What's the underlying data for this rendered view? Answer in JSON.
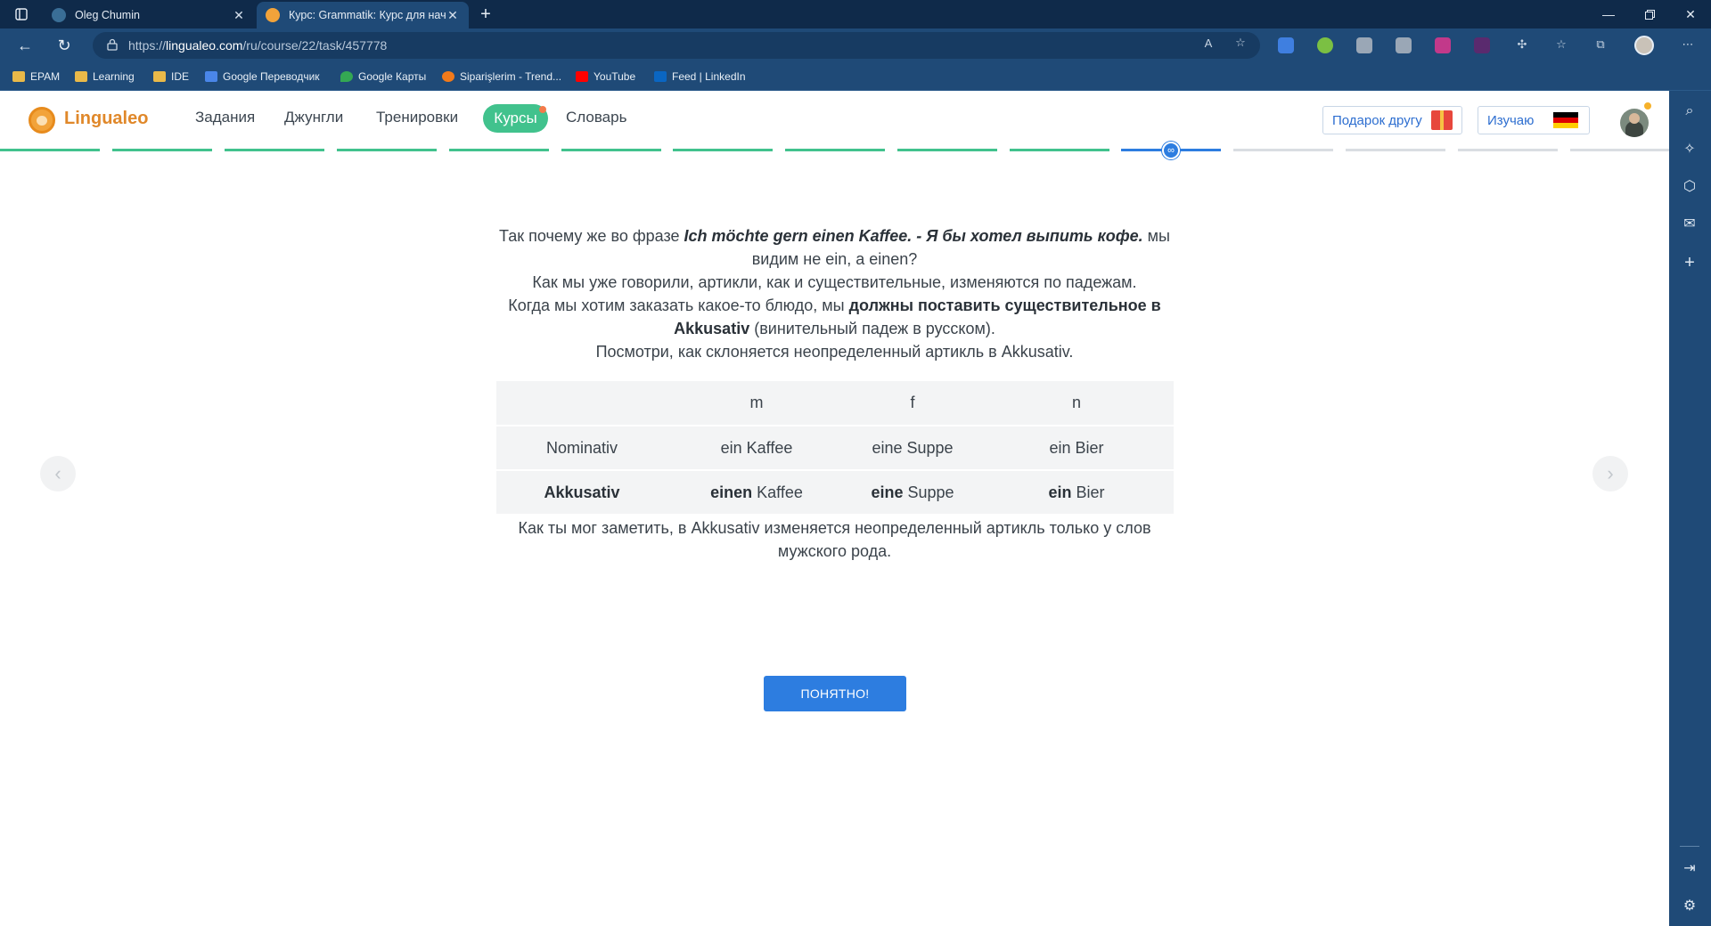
{
  "browser": {
    "tabs": [
      {
        "title": "Oleg Chumin",
        "active": false
      },
      {
        "title": "Курс: Grammatik: Курс для начи",
        "active": true
      }
    ],
    "new_tab": "+",
    "url_prefix": "https://",
    "url_host": "lingualeo.com",
    "url_path": "/ru/course/22/task/457778",
    "bookmarks": [
      {
        "label": "EPAM",
        "icon": "folder-icon"
      },
      {
        "label": "Learning",
        "icon": "folder-icon"
      },
      {
        "label": "IDE",
        "icon": "folder-icon"
      },
      {
        "label": "Google Переводчик",
        "icon": "google-translate-icon"
      },
      {
        "label": "Google Карты",
        "icon": "google-maps-icon"
      },
      {
        "label": "Siparişlerim - Trend...",
        "icon": "trendyol-icon"
      },
      {
        "label": "YouTube",
        "icon": "youtube-icon"
      },
      {
        "label": "Feed | LinkedIn",
        "icon": "linkedin-icon"
      }
    ]
  },
  "site": {
    "logo": "Lingualeo",
    "nav": [
      {
        "label": "Задания"
      },
      {
        "label": "Джунгли"
      },
      {
        "label": "Тренировки"
      },
      {
        "label": "Курсы",
        "active": true
      },
      {
        "label": "Словарь"
      }
    ],
    "gift_button": "Подарок другу",
    "learning_button": "Изучаю",
    "progress": {
      "segments_total": 15,
      "completed": 10,
      "current_index": 10
    }
  },
  "lesson": {
    "line1_a": "Так почему же во фразе ",
    "line1_em": "Ich möchte gern einen Kaffee. - Я бы хотел выпить кофе.",
    "line1_b": " мы",
    "line2": "видим не ein, а einen?",
    "line3": "Как мы уже говорили, артикли, как и существительные, изменяются по падежам.",
    "line4_a": "Когда мы хотим заказать какое-то блюдо, мы ",
    "line4_b": "должны поставить существительное в",
    "line5_b": "Akkusativ",
    "line5_a": " (винительный падеж в русском).",
    "line6": "Посмотри, как склоняется неопределенный артикль в Akkusativ.",
    "table": {
      "headers": [
        "",
        "m",
        "f",
        "n"
      ],
      "rows": [
        {
          "case": "Nominativ",
          "m_art": "ein",
          "m_noun": "Kaffee",
          "f_art": "eine",
          "f_noun": "Suppe",
          "n_art": "ein",
          "n_noun": "Bier",
          "bold": false
        },
        {
          "case": "Akkusativ",
          "m_art": "einen",
          "m_noun": "Kaffee",
          "f_art": "eine",
          "f_noun": "Suppe",
          "n_art": "ein",
          "n_noun": "Bier",
          "bold": true
        }
      ]
    },
    "after1": "Как ты мог заметить, в Akkusativ изменяется неопределенный артикль только у слов",
    "after2": "мужского рода.",
    "ok_button": "ПОНЯТНО!"
  },
  "colors": {
    "accent_blue": "#2d7de0",
    "accent_green": "#41c28d",
    "logo_orange": "#e0882a"
  }
}
